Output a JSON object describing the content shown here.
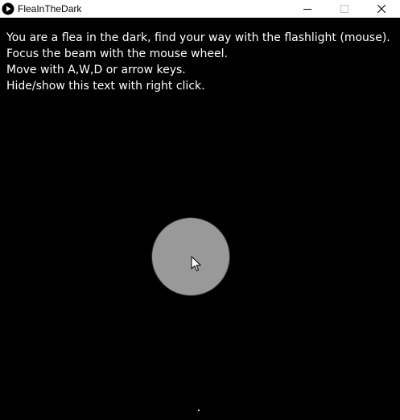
{
  "window": {
    "title": "FleaInTheDark",
    "app_icon": "play-circle-icon",
    "controls": [
      "minimize-icon",
      "maximize-icon",
      "close-icon"
    ]
  },
  "game": {
    "instructions": [
      "You are a flea in the dark, find your way with the flashlight (mouse).",
      "Focus the beam with the mouse wheel.",
      "Move with A,W,D or arrow keys.",
      "Hide/show this text with right click."
    ],
    "colors": {
      "background": "#000000",
      "text": "#ffffff",
      "beam": "#999999",
      "flea": "#cfcfcf"
    },
    "cursor_icon": "arrow-cursor-icon"
  }
}
